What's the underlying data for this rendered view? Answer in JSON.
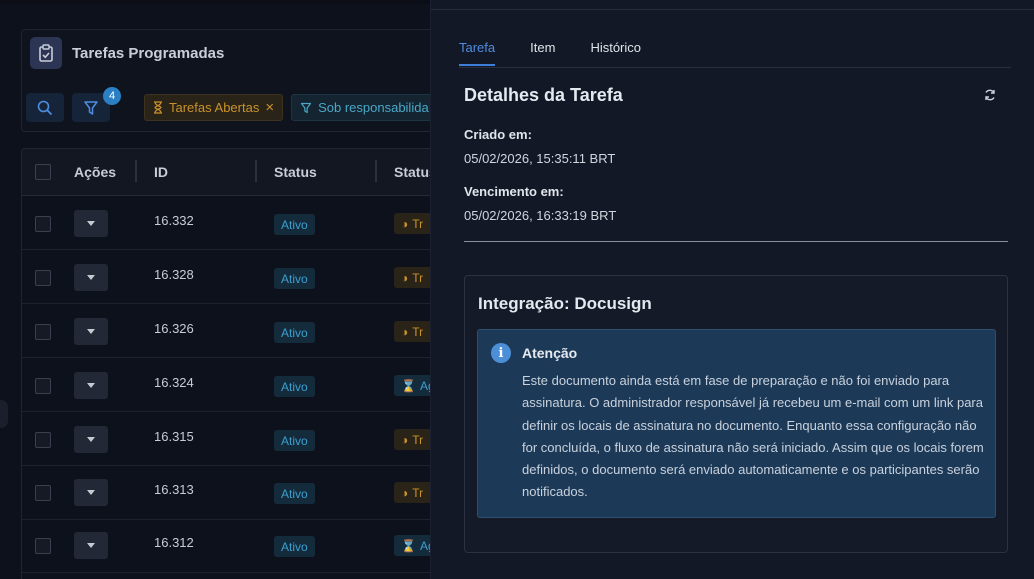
{
  "left": {
    "card_title": "Tarefas Programadas",
    "filter_badge": "4",
    "chips": [
      {
        "label": "Tarefas Abertas",
        "close": "×"
      },
      {
        "label": "Sob responsabilida"
      }
    ],
    "table": {
      "headers": {
        "acoes": "Ações",
        "id": "ID",
        "status": "Status",
        "status2": "Status"
      },
      "rows": [
        {
          "id": "16.332",
          "status": "Ativo",
          "status2": "Tr",
          "status2_color": "orange"
        },
        {
          "id": "16.328",
          "status": "Ativo",
          "status2": "Tr",
          "status2_color": "orange"
        },
        {
          "id": "16.326",
          "status": "Ativo",
          "status2": "Tr",
          "status2_color": "orange"
        },
        {
          "id": "16.324",
          "status": "Ativo",
          "status2": "Ag",
          "status2_color": "blue"
        },
        {
          "id": "16.315",
          "status": "Ativo",
          "status2": "Tr",
          "status2_color": "orange"
        },
        {
          "id": "16.313",
          "status": "Ativo",
          "status2": "Tr",
          "status2_color": "orange"
        },
        {
          "id": "16.312",
          "status": "Ativo",
          "status2": "Ag",
          "status2_color": "blue"
        }
      ]
    }
  },
  "right": {
    "tabs": [
      "Tarefa",
      "Item",
      "Histórico"
    ],
    "active_tab": "Tarefa",
    "detail_title": "Detalhes da Tarefa",
    "created_label": "Criado em:",
    "created_value": "05/02/2026, 15:35:11 BRT",
    "due_label": "Vencimento em:",
    "due_value": "05/02/2026, 16:33:19 BRT",
    "integration_title": "Integração: Docusign",
    "alert": {
      "title": "Atenção",
      "icon": "info-icon",
      "body": "Este documento ainda está em fase de preparação e não foi enviado para assinatura. O administrador responsável já recebeu um e-mail com um link para definir os locais de assinatura no documento. Enquanto essa configuração não for concluída, o fluxo de assinatura não será iniciado. Assim que os locais forem definidos, o documento será enviado automaticamente e os participantes serão notificados."
    }
  },
  "colors": {
    "accent": "#3d7fd6",
    "status_blue": "#3c9fcf",
    "status_orange": "#c9922c",
    "alert_bg": "#1c3a58"
  }
}
